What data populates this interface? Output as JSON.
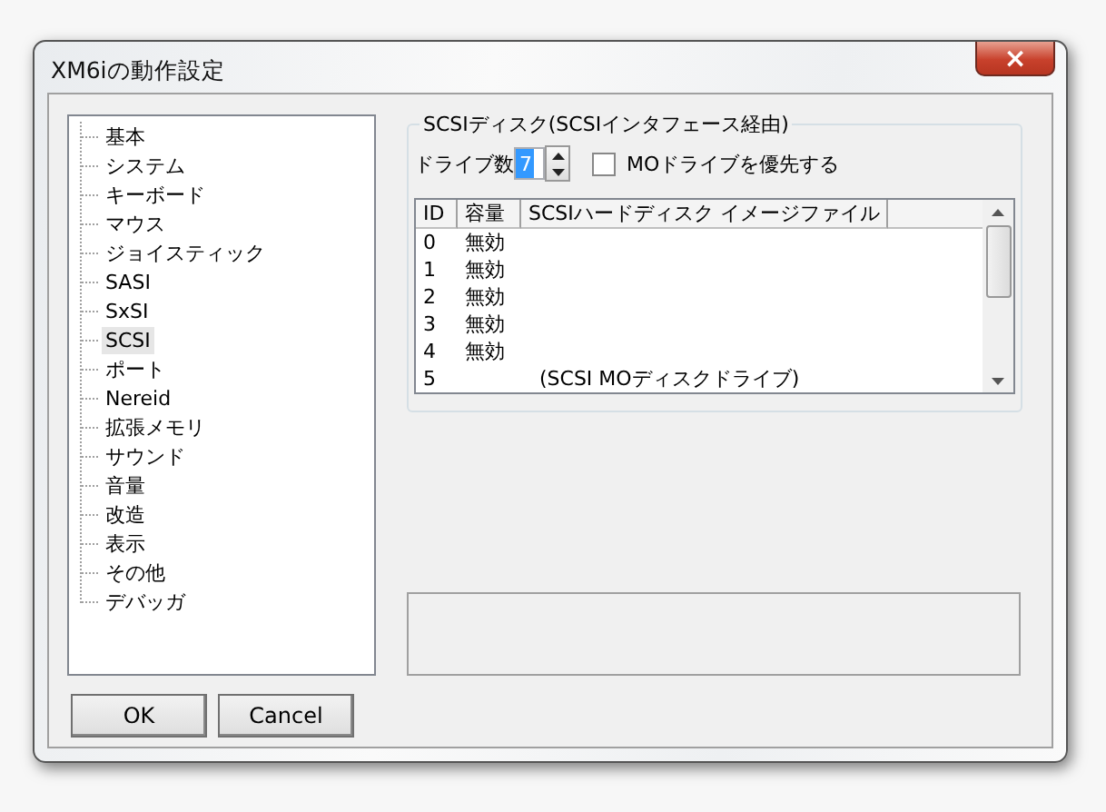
{
  "window": {
    "title": "XM6iの動作設定",
    "close": "×"
  },
  "tree": {
    "items": [
      {
        "label": "基本",
        "selected": false
      },
      {
        "label": "システム",
        "selected": false
      },
      {
        "label": "キーボード",
        "selected": false
      },
      {
        "label": "マウス",
        "selected": false
      },
      {
        "label": "ジョイスティック",
        "selected": false
      },
      {
        "label": "SASI",
        "selected": false
      },
      {
        "label": "SxSI",
        "selected": false
      },
      {
        "label": "SCSI",
        "selected": true
      },
      {
        "label": "ポート",
        "selected": false
      },
      {
        "label": "Nereid",
        "selected": false
      },
      {
        "label": "拡張メモリ",
        "selected": false
      },
      {
        "label": "サウンド",
        "selected": false
      },
      {
        "label": "音量",
        "selected": false
      },
      {
        "label": "改造",
        "selected": false
      },
      {
        "label": "表示",
        "selected": false
      },
      {
        "label": "その他",
        "selected": false
      },
      {
        "label": "デバッガ",
        "selected": false
      }
    ]
  },
  "scsi_group": {
    "title": "SCSIディスク(SCSIインタフェース経由)",
    "drive_count": {
      "label": "ドライブ数",
      "value": "7"
    },
    "mo_priority": {
      "label": "MOドライブを優先する",
      "checked": false
    },
    "table": {
      "columns": [
        "ID",
        "容量",
        "SCSIハードディスク イメージファイル"
      ],
      "rows": [
        [
          "0",
          "無効",
          ""
        ],
        [
          "1",
          "無効",
          ""
        ],
        [
          "2",
          "無効",
          ""
        ],
        [
          "3",
          "無効",
          ""
        ],
        [
          "4",
          "無効",
          ""
        ],
        [
          "5",
          "",
          "(SCSI MOディスクドライブ)"
        ]
      ]
    }
  },
  "buttons": [
    "OK",
    "Cancel"
  ]
}
